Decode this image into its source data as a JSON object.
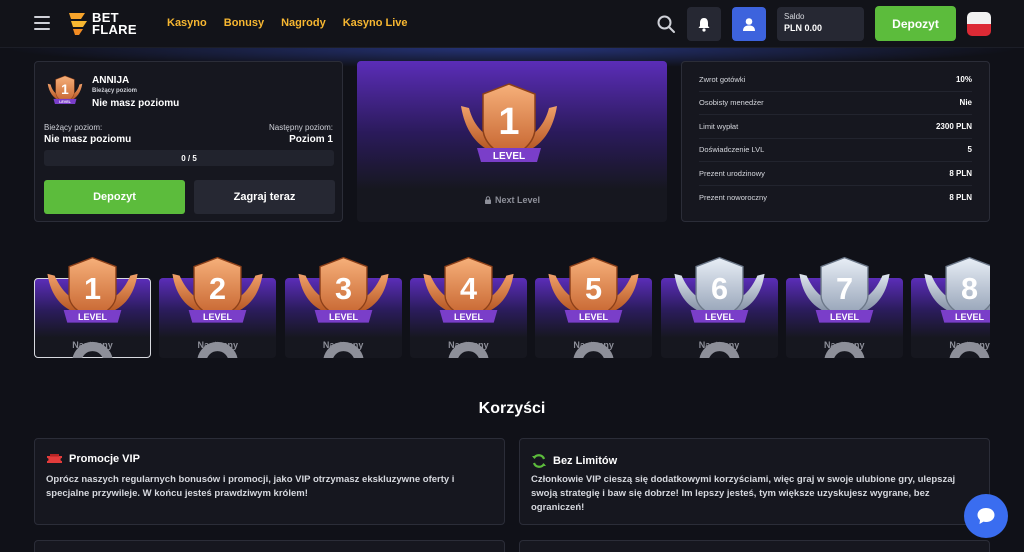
{
  "header": {
    "logo_line1": "BET",
    "logo_line2": "FLARE",
    "nav": [
      "Kasyno",
      "Bonusy",
      "Nagrody",
      "Kasyno Live"
    ],
    "balance_label": "Saldo",
    "balance_value": "PLN 0.00",
    "deposit_label": "Depozyt",
    "accent": "#f7b731"
  },
  "status": {
    "username": "ANNIJA",
    "current_level_label": "Bieżący poziom",
    "current_level_value": "Nie masz poziomu",
    "current_label": "Bieżący poziom:",
    "current_value": "Nie masz poziomu",
    "next_label": "Następny poziom:",
    "next_value": "Poziom 1",
    "progress_text": "0 / 5",
    "deposit_label": "Depozyt",
    "play_label": "Zagraj teraz",
    "badge_number": "1",
    "badge_word": "LEVEL"
  },
  "center": {
    "badge_number": "1",
    "badge_word": "LEVEL",
    "next_level": "Next Level"
  },
  "stats": [
    {
      "k": "Zwrot gotówki",
      "v": "10%"
    },
    {
      "k": "Osobisty menedżer",
      "v": "Nie"
    },
    {
      "k": "Limit wypłat",
      "v": "2300 PLN"
    },
    {
      "k": "Doświadczenie LVL",
      "v": "5"
    },
    {
      "k": "Prezent urodzinowy",
      "v": "8 PLN"
    },
    {
      "k": "Prezent noworoczny",
      "v": "8 PLN"
    }
  ],
  "levels": [
    {
      "n": "1",
      "word": "LEVEL",
      "next": "Następny",
      "tier": "bronze"
    },
    {
      "n": "2",
      "word": "LEVEL",
      "next": "Następny",
      "tier": "bronze"
    },
    {
      "n": "3",
      "word": "LEVEL",
      "next": "Następny",
      "tier": "bronze"
    },
    {
      "n": "4",
      "word": "LEVEL",
      "next": "Następny",
      "tier": "bronze"
    },
    {
      "n": "5",
      "word": "LEVEL",
      "next": "Następny",
      "tier": "bronze"
    },
    {
      "n": "6",
      "word": "LEVEL",
      "next": "Następny",
      "tier": "silver"
    },
    {
      "n": "7",
      "word": "LEVEL",
      "next": "Następny",
      "tier": "silver"
    },
    {
      "n": "8",
      "word": "LEVEL",
      "next": "Następny",
      "tier": "silver"
    }
  ],
  "benefits": {
    "title": "Korzyści",
    "items": [
      {
        "icon": "ticket-icon",
        "title": "Promocje VIP",
        "desc": "Oprócz naszych regularnych bonusów i promocji, jako VIP otrzymasz ekskluzywne oferty i specjalne przywileje. W końcu jesteś prawdziwym królem!"
      },
      {
        "icon": "refresh-icon",
        "title": "Bez Limitów",
        "desc": "Członkowie VIP cieszą się dodatkowymi korzyściami, więc graj w swoje ulubione gry, ulepszaj swoją strategię i baw się dobrze! Im lepszy jesteś, tym większe uzyskujesz wygrane, bez ograniczeń!"
      }
    ]
  },
  "colors": {
    "green": "#5cbc3c",
    "purple": "#5b2db8",
    "bronze": "#e08a4e",
    "silver": "#b8c4d4"
  }
}
